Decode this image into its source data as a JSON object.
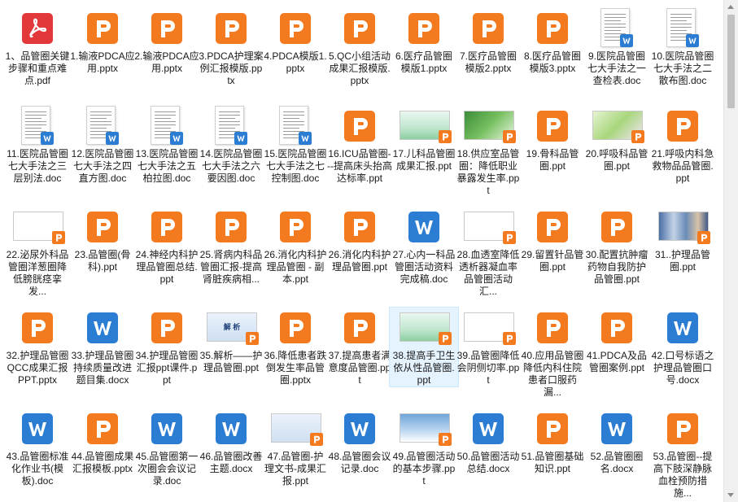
{
  "colors": {
    "ppt": "#f47a20",
    "word": "#2b7cd3",
    "pdf": "#e3383a",
    "selection": "#e5f3ff"
  },
  "files": [
    {
      "label": "1、品管圈关键步骤和重点难点.pdf",
      "type": "pdf"
    },
    {
      "label": "1.输液PDCA应用.pptx",
      "type": "ppt"
    },
    {
      "label": "2.输液PDCA应用.pptx",
      "type": "ppt"
    },
    {
      "label": "3.PDCA护理案例汇报模版.pptx",
      "type": "ppt"
    },
    {
      "label": "4.PDCA模版1.pptx",
      "type": "ppt"
    },
    {
      "label": "5.QC小组活动成果汇报模版.pptx",
      "type": "ppt"
    },
    {
      "label": "6.医疗品管圈模版1.pptx",
      "type": "ppt"
    },
    {
      "label": "7.医疗品管圈模版2.pptx",
      "type": "ppt"
    },
    {
      "label": "8.医疗品管圈模版3.pptx",
      "type": "ppt"
    },
    {
      "label": "9.医院品管圈七大手法之一查检表.doc",
      "type": "docpage"
    },
    {
      "label": "10.医院品管圈七大手法之二散布图.doc",
      "type": "docpage"
    },
    {
      "label": "11.医院品管圈七大手法之三层别法.doc",
      "type": "docpage"
    },
    {
      "label": "12.医院品管圈七大手法之四直方图.doc",
      "type": "docpage"
    },
    {
      "label": "13.医院品管圈七大手法之五柏拉图.doc",
      "type": "docpage"
    },
    {
      "label": "14.医院品管圈七大手法之六要因图.doc",
      "type": "docpage"
    },
    {
      "label": "15.医院品管圈七大手法之七控制图.doc",
      "type": "docpage"
    },
    {
      "label": "16.ICU品管圈---提高床头抬高达标率.ppt",
      "type": "ppt"
    },
    {
      "label": "17.儿科品管圈成果汇报.ppt",
      "type": "thumb",
      "thumb": "green"
    },
    {
      "label": "18.供应室品管圈：降低职业暴露发生率.ppt",
      "type": "thumb",
      "thumb": "panda"
    },
    {
      "label": "19.骨科品管圈.ppt",
      "type": "ppt"
    },
    {
      "label": "20.呼吸科品管圈.ppt",
      "type": "thumb",
      "thumb": "flower"
    },
    {
      "label": "21.呼吸内科急救物品品管圈.ppt",
      "type": "ppt"
    },
    {
      "label": "22.泌尿外科品管圈洋葱圈降低膀胱痉挛发...",
      "type": "thumb",
      "thumb": "white"
    },
    {
      "label": "23.品管圈(骨科).ppt",
      "type": "ppt"
    },
    {
      "label": "24.神经内科护理品管圈总结.ppt",
      "type": "ppt"
    },
    {
      "label": "25.肾病内科品管圈汇报-提高肾脏疾病相...",
      "type": "ppt"
    },
    {
      "label": "26.消化内科护理品管圈 - 副本.ppt",
      "type": "ppt"
    },
    {
      "label": "26.消化内科护理品管圈.ppt",
      "type": "ppt"
    },
    {
      "label": "27.心内一科品管圈活动资料完成稿.doc",
      "type": "word"
    },
    {
      "label": "28.血透室降低透析器凝血率品管圈活动汇...",
      "type": "thumb",
      "thumb": "white"
    },
    {
      "label": "29.留置针品管圈.ppt",
      "type": "ppt"
    },
    {
      "label": "30.配置抗肿瘤药物自我防护品管圈.ppt",
      "type": "ppt"
    },
    {
      "label": "31..护理品管圈.ppt",
      "type": "thumb",
      "thumb": "photo"
    },
    {
      "label": "32.护理品管圈QCC成果汇报PPT.pptx",
      "type": "ppt"
    },
    {
      "label": "33.护理品管圈持续质量改进题目集.docx",
      "type": "word"
    },
    {
      "label": "34.护理品管圈汇报ppt课件.ppt",
      "type": "ppt"
    },
    {
      "label": "35.解析——护理品管圈.ppt",
      "type": "thumb",
      "thumb": "blue",
      "text": "解 析"
    },
    {
      "label": "36.降低患者跌倒发生率品管圈.pptx",
      "type": "ppt"
    },
    {
      "label": "37.提高患者满意度品管圈.ppt",
      "type": "ppt"
    },
    {
      "label": "38.提高手卫生依从性品管圈.ppt",
      "type": "thumb",
      "thumb": "green",
      "selected": true
    },
    {
      "label": "39.品管圈降低会阴侧切率.ppt",
      "type": "thumb",
      "thumb": "white"
    },
    {
      "label": "40.应用品管圈降低内科住院患者口服药漏...",
      "type": "ppt"
    },
    {
      "label": "41.PDCA及品管圈案例.ppt",
      "type": "ppt"
    },
    {
      "label": "42.口号标语之护理品管圈口号.docx",
      "type": "word"
    },
    {
      "label": "43.品管圈标准化作业书(模板).doc",
      "type": "word"
    },
    {
      "label": "44.品管圈成果汇报模板.pptx",
      "type": "ppt"
    },
    {
      "label": "45.品管圈第一次圈会会议记录.doc",
      "type": "word"
    },
    {
      "label": "46.品管圈改善主题.docx",
      "type": "word"
    },
    {
      "label": "47.品管圈-护理文书-成果汇报.ppt",
      "type": "thumb",
      "thumb": "blue"
    },
    {
      "label": "48.品管圈会议记录.doc",
      "type": "word"
    },
    {
      "label": "49.品管圈活动的基本步骤.ppt",
      "type": "thumb",
      "thumb": "sky"
    },
    {
      "label": "50.品管圈活动总结.docx",
      "type": "word"
    },
    {
      "label": "51.品管圈基础知识.ppt",
      "type": "ppt"
    },
    {
      "label": "52.品管圈圈名.docx",
      "type": "word"
    },
    {
      "label": "53.品管圈--提高下肢深静脉血栓预防措施...",
      "type": "ppt"
    }
  ]
}
